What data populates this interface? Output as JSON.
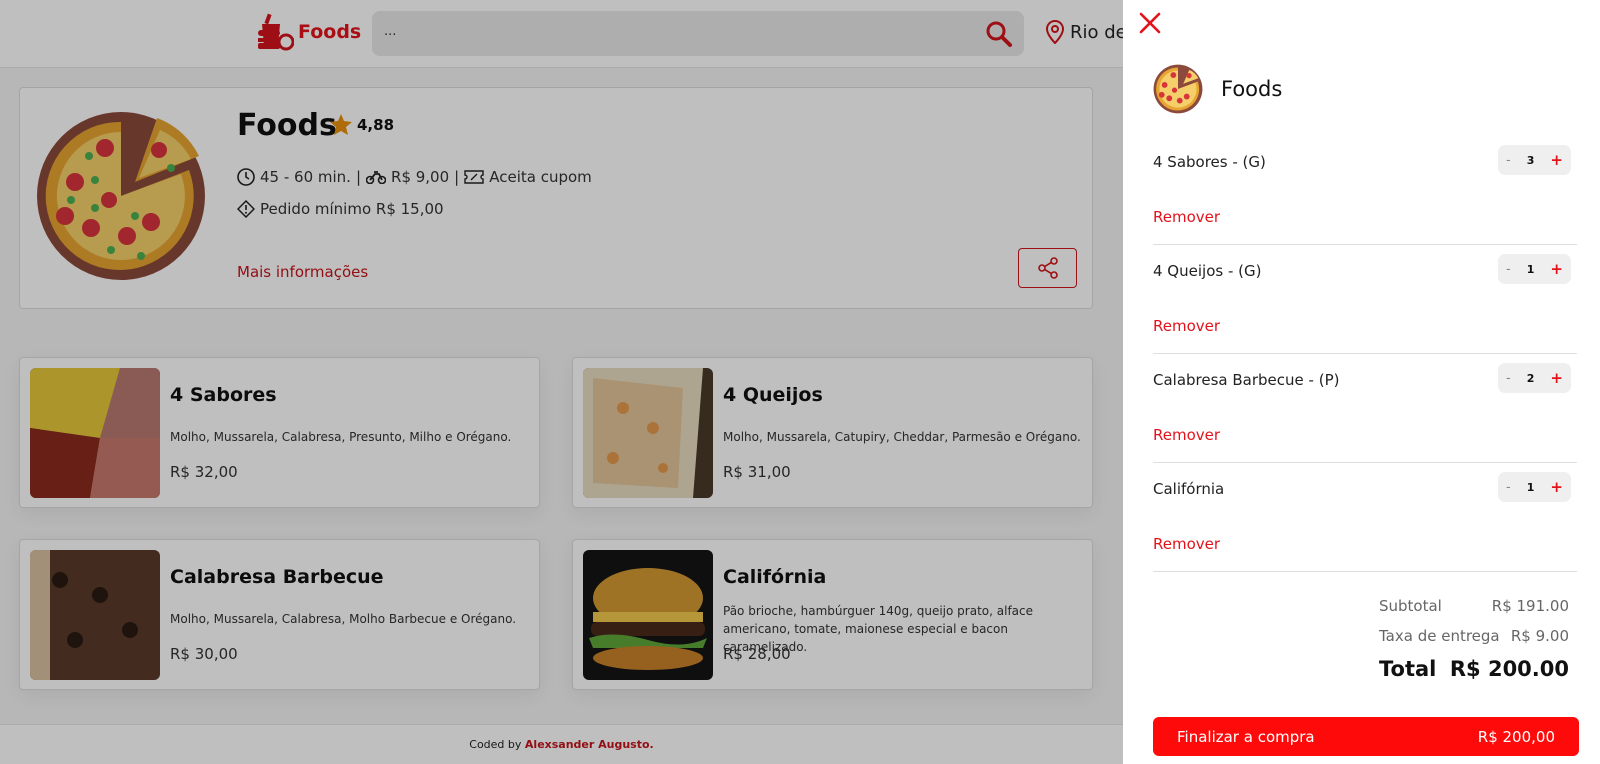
{
  "header": {
    "brand": "Foods",
    "search_value": "...",
    "location": "Rio de"
  },
  "store": {
    "name": "Foods",
    "rating": "4,88",
    "delivery_time": "45 - 60 min.",
    "separator": "|",
    "delivery_fee": "R$ 9,00",
    "coupon": "Aceita cupom",
    "min_order": "Pedido mínimo R$ 15,00",
    "more_info": "Mais informações"
  },
  "products": [
    {
      "name": "4 Sabores",
      "description": "Molho, Mussarela, Calabresa, Presunto, Milho e Orégano.",
      "price": "R$ 32,00"
    },
    {
      "name": "4 Queijos",
      "description": "Molho, Mussarela, Catupiry, Cheddar, Parmesão e Orégano.",
      "price": "R$ 31,00"
    },
    {
      "name": "Calabresa Barbecue",
      "description": "Molho, Mussarela, Calabresa, Molho Barbecue e Orégano.",
      "price": "R$ 30,00"
    },
    {
      "name": "Califórnia",
      "description": "Pão brioche, hambúrguer 140g, queijo prato, alface americano, tomate, maionese especial e bacon caramelizado.",
      "price": "R$ 28,00"
    }
  ],
  "footer": {
    "prefix": "Coded by",
    "author": "Alexsander Augusto."
  },
  "cart": {
    "store_name": "Foods",
    "remove_label": "Remover",
    "items": [
      {
        "name": "4 Sabores - (G)",
        "qty": "3"
      },
      {
        "name": "4 Queijos - (G)",
        "qty": "1"
      },
      {
        "name": "Calabresa Barbecue - (P)",
        "qty": "2"
      },
      {
        "name": "Califórnia",
        "qty": "1"
      }
    ],
    "minus": "-",
    "plus": "+",
    "subtotal_label": "Subtotal",
    "subtotal_value": "R$ 191.00",
    "fee_label": "Taxa de entrega",
    "fee_value": "R$ 9.00",
    "total_label": "Total",
    "total_value": "R$ 200.00",
    "checkout_label": "Finalizar a compra",
    "checkout_value": "R$ 200,00"
  },
  "colors": {
    "accent": "#e3131b",
    "checkout": "#fe0a0a"
  }
}
